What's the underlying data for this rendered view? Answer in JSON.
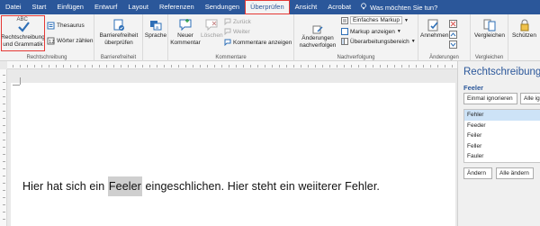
{
  "tabs": [
    "Datei",
    "Start",
    "Einfügen",
    "Entwurf",
    "Layout",
    "Referenzen",
    "Sendungen",
    "Überprüfen",
    "Ansicht",
    "Acrobat"
  ],
  "active_tab_index": 7,
  "tell_me": "Was möchten Sie tun?",
  "ribbon": {
    "spelling": {
      "abc": "ABC",
      "line1": "Rechtschreibung",
      "line2": "und Grammatik",
      "label": "Rechtschreibung"
    },
    "thesaurus": "Thesaurus",
    "word_count": "Wörter zählen",
    "accessibility": {
      "line1": "Barrierefreiheit",
      "line2": "überprüfen",
      "label": "Barrierefreiheit"
    },
    "language": "Sprache",
    "new_comment": {
      "line1": "Neuer",
      "line2": "Kommentar"
    },
    "delete": "Löschen",
    "previous": "Zurück",
    "next": "Weiter",
    "show_comments": "Kommentare anzeigen",
    "comments_label": "Kommentare",
    "track_changes": {
      "line1": "Änderungen",
      "line2": "nachverfolgen"
    },
    "markup_select": "Einfaches Markup",
    "show_markup": "Markup anzeigen",
    "reviewing_pane": "Überarbeitungsbereich",
    "tracking_label": "Nachverfolgung",
    "accept": "Annehmen",
    "changes_label": "Änderungen",
    "compare": "Vergleichen",
    "compare_label": "Vergleichen",
    "protect": "Schützen"
  },
  "document": {
    "before": "Hier hat sich ein ",
    "misspelled": "Feeler",
    "after": " eingeschlichen. Hier steht ein weiiterer Fehler."
  },
  "pane": {
    "title": "Rechtschreibung",
    "error_word": "Feeler",
    "ignore_once": "Einmal ignorieren",
    "ignore_all": "Alle ignorieren",
    "suggestions": [
      "Fehler",
      "Feeder",
      "Feiler",
      "Feller",
      "Fauler"
    ],
    "selected_index": 0,
    "change": "Ändern",
    "change_all": "Alle ändern"
  },
  "colors": {
    "accent": "#2b579a",
    "highlight_red": "#e53935",
    "check_blue": "#2e6fb7"
  }
}
